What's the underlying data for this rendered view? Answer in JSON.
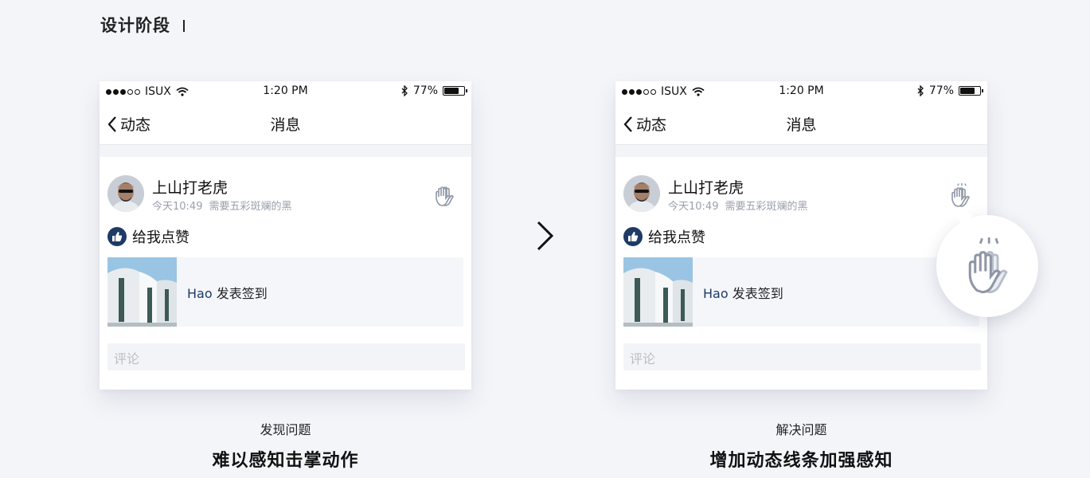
{
  "page": {
    "title": "设计阶段"
  },
  "phones": [
    {
      "status": {
        "carrier": "ISUX",
        "time": "1:20 PM",
        "battery": "77%",
        "battery_level": 0.77
      },
      "nav": {
        "back_label": "动态",
        "title": "消息"
      },
      "post": {
        "username": "上山打老虎",
        "time": "今天10:49",
        "subtitle": "需要五彩斑斓的黑",
        "like_text": "给我点赞",
        "share_who": "Hao",
        "share_action": "发表签到",
        "comment_placeholder": "评论"
      },
      "caption": "发现问题",
      "headline": "难以感知击掌动作"
    },
    {
      "status": {
        "carrier": "ISUX",
        "time": "1:20 PM",
        "battery": "77%",
        "battery_level": 0.77
      },
      "nav": {
        "back_label": "动态",
        "title": "消息"
      },
      "post": {
        "username": "上山打老虎",
        "time": "今天10:49",
        "subtitle": "需要五彩斑斓的黑",
        "like_text": "给我点赞",
        "share_who": "Hao",
        "share_action": "发表签到",
        "comment_placeholder": "评论"
      },
      "caption": "解决问题",
      "headline": "增加动态线条加强感知"
    }
  ],
  "icons": {
    "back": "chevron-left-icon",
    "clap": "clap-hand-icon",
    "like": "thumbs-up-icon",
    "next": "chevron-right-icon",
    "wifi": "wifi-icon",
    "bluetooth": "bluetooth-icon",
    "battery": "battery-icon"
  },
  "colors": {
    "accent": "#1e3a66",
    "background": "#f4f5f9",
    "muted": "#9aa0ab"
  }
}
